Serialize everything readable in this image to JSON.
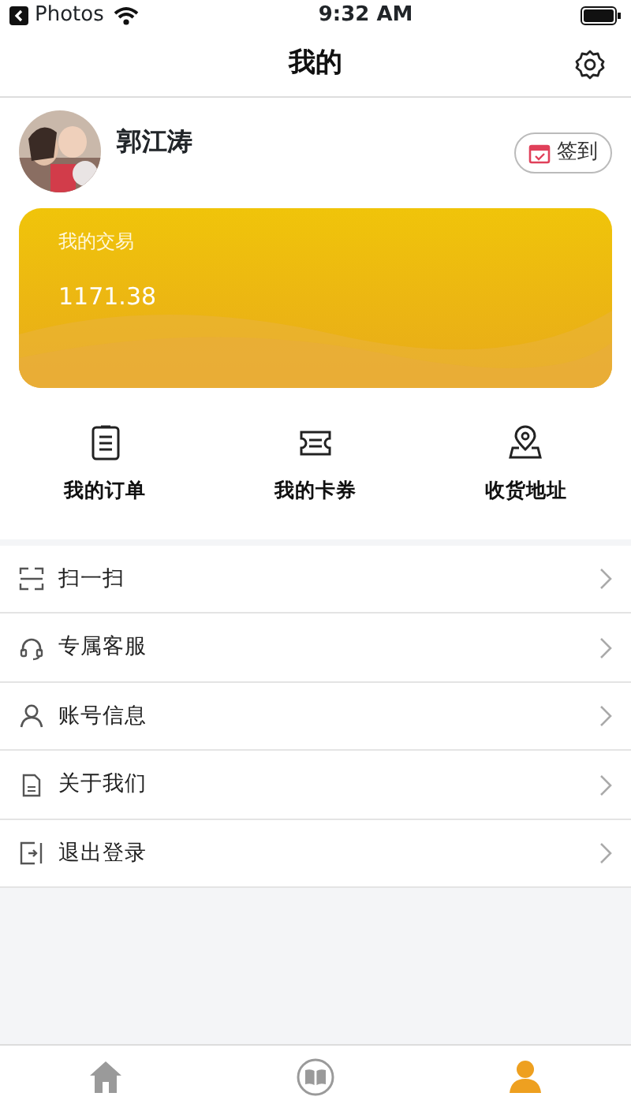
{
  "status_bar": {
    "back_app": "Photos",
    "time": "9:32 AM"
  },
  "nav": {
    "title": "我的"
  },
  "profile": {
    "name": "郭江涛",
    "checkin_label": "签到"
  },
  "trade_card": {
    "title": "我的交易",
    "amount": "1171.38"
  },
  "shortcuts": [
    {
      "kind": "order",
      "label": "我的订单"
    },
    {
      "kind": "coupon",
      "label": "我的卡券"
    },
    {
      "kind": "address",
      "label": "收货地址"
    }
  ],
  "menu": [
    {
      "kind": "scan",
      "label": "扫一扫"
    },
    {
      "kind": "service",
      "label": "专属客服"
    },
    {
      "kind": "account",
      "label": "账号信息"
    },
    {
      "kind": "about",
      "label": "关于我们"
    },
    {
      "kind": "logout",
      "label": "退出登录"
    }
  ],
  "tab_bar": [
    {
      "kind": "home",
      "selected": false
    },
    {
      "kind": "academy",
      "selected": false
    },
    {
      "kind": "me",
      "selected": true
    }
  ]
}
